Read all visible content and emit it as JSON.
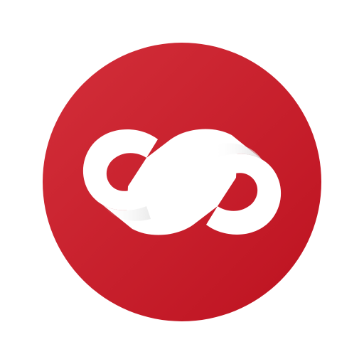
{
  "icon": {
    "name": "infinity-link-logo",
    "shape": "circle",
    "colors": {
      "background_light": "#d32f3a",
      "background_dark": "#bd1220",
      "glyph": "#ffffff",
      "glyph_shade": "#d9d9d9",
      "page": "#ffffff"
    }
  }
}
